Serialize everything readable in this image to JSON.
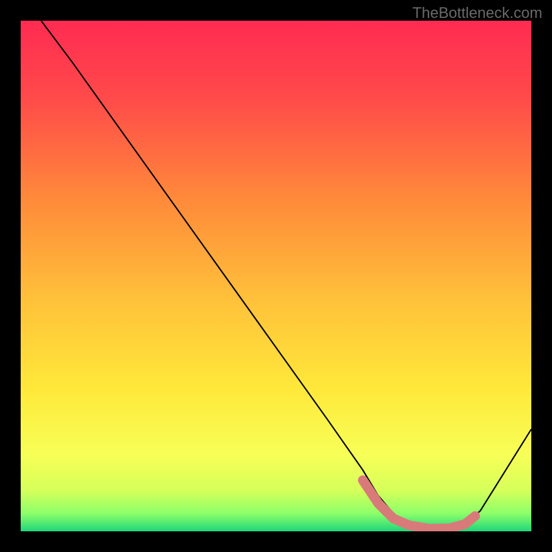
{
  "watermark": "TheBottleneck.com",
  "chart_data": {
    "type": "line",
    "title": "",
    "xlabel": "",
    "ylabel": "",
    "xlim": [
      0,
      100
    ],
    "ylim": [
      0,
      100
    ],
    "series": [
      {
        "name": "bottleneck-curve",
        "x": [
          4,
          10,
          20,
          30,
          40,
          50,
          60,
          67,
          70,
          73,
          76,
          80,
          84,
          87,
          90,
          100
        ],
        "y": [
          100,
          92,
          78,
          64,
          50,
          36,
          22,
          12,
          7,
          3.5,
          1.5,
          0.5,
          0.5,
          1.5,
          4,
          20
        ]
      }
    ],
    "highlight": {
      "name": "optimal-range",
      "color": "#d97a7a",
      "x": [
        67,
        70,
        73,
        76,
        80,
        84,
        87,
        89
      ],
      "y": [
        10,
        5.5,
        2.5,
        1.2,
        0.5,
        0.6,
        1.4,
        3
      ]
    },
    "background_gradient": {
      "stops": [
        {
          "offset": 0.0,
          "color": "#ff2b52"
        },
        {
          "offset": 0.15,
          "color": "#ff4a4a"
        },
        {
          "offset": 0.35,
          "color": "#ff8a3a"
        },
        {
          "offset": 0.55,
          "color": "#ffc23a"
        },
        {
          "offset": 0.72,
          "color": "#ffe83a"
        },
        {
          "offset": 0.85,
          "color": "#f7ff57"
        },
        {
          "offset": 0.92,
          "color": "#d6ff5a"
        },
        {
          "offset": 0.965,
          "color": "#8dff6a"
        },
        {
          "offset": 1.0,
          "color": "#1fd67a"
        }
      ]
    }
  }
}
